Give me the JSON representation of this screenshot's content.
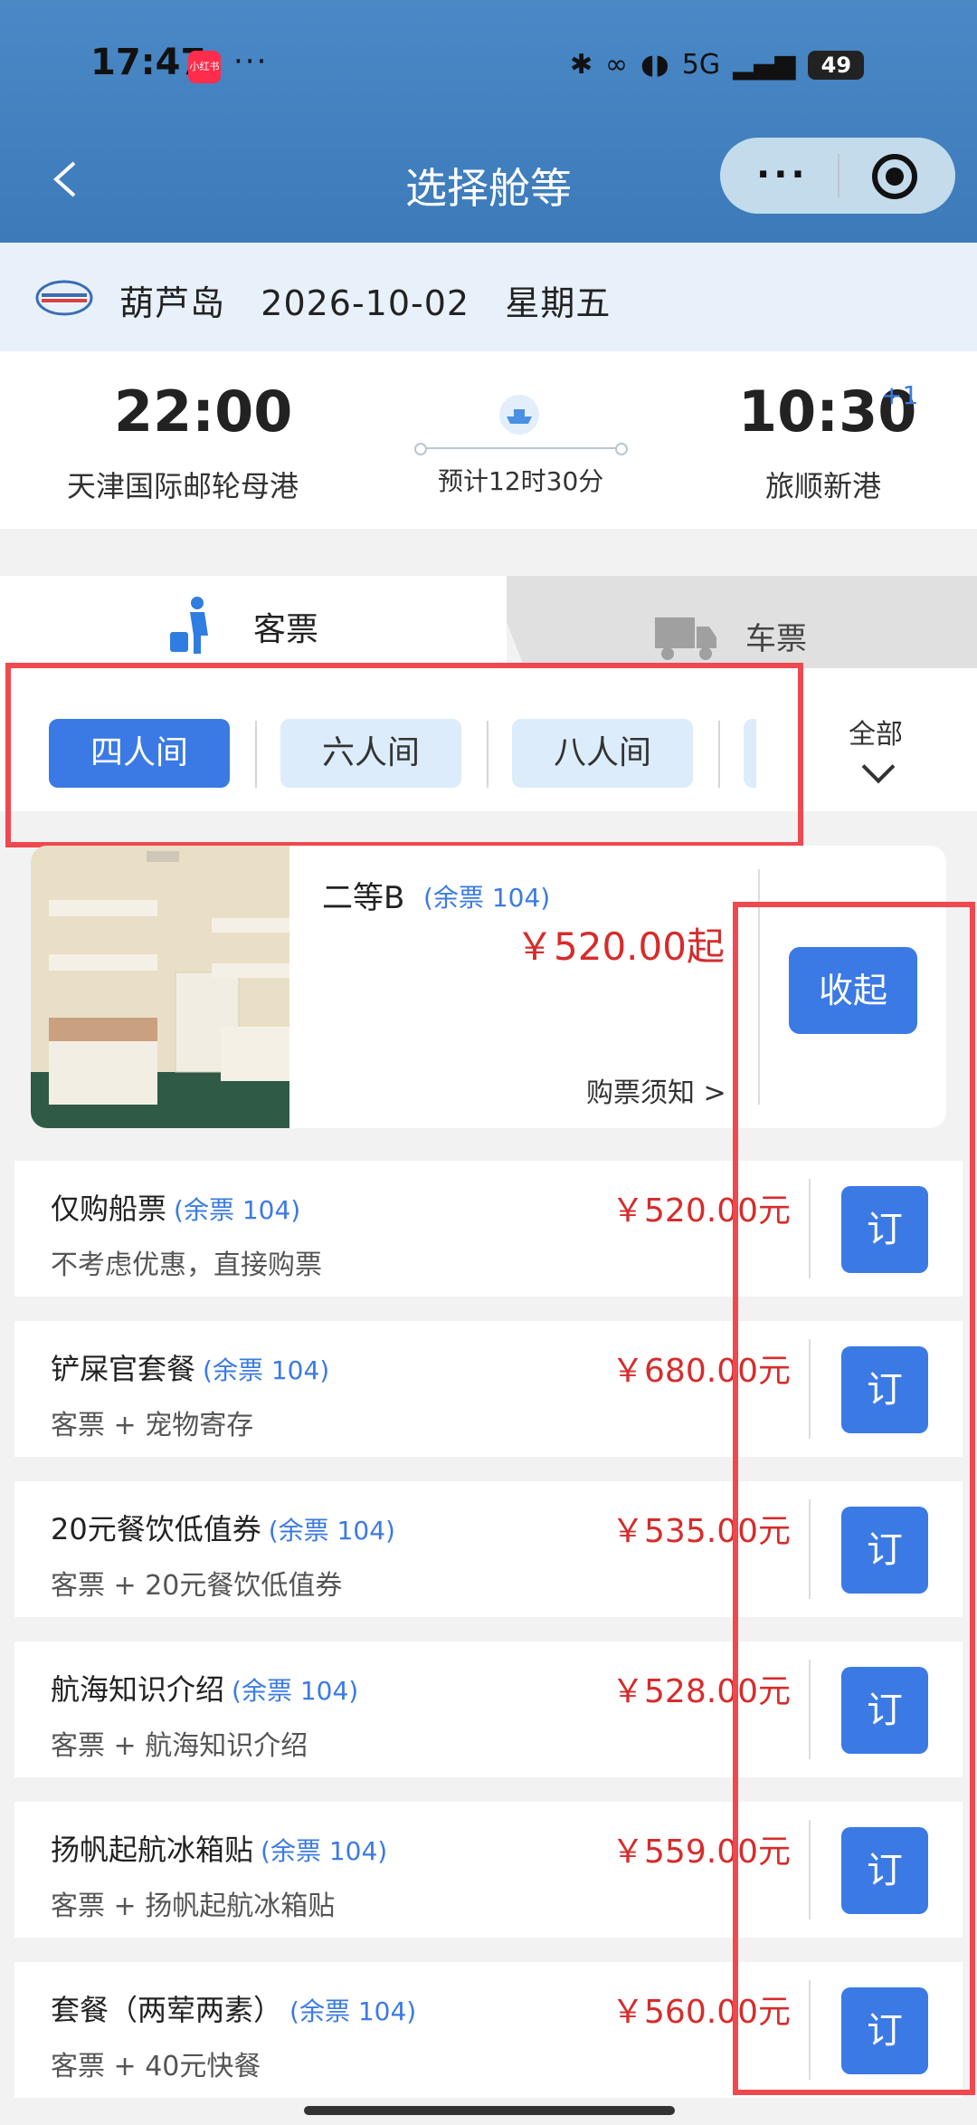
{
  "status": {
    "time": "17:47",
    "app_badge": "小红书",
    "dots": "···",
    "signal": "5G",
    "battery": "49"
  },
  "header": {
    "title": "选择舱等",
    "more": "···"
  },
  "route": {
    "dest": "葫芦岛",
    "date": "2026-10-02",
    "weekday": "星期五"
  },
  "schedule": {
    "dep_time": "22:00",
    "dep_port": "天津国际邮轮母港",
    "duration": "预计12时30分",
    "arr_time": "10:30",
    "arr_plus": "+1",
    "arr_port": "旅顺新港"
  },
  "tabs": {
    "passenger": "客票",
    "vehicle": "车票"
  },
  "cabin_types": {
    "items": [
      "四人间",
      "六人间",
      "八人间"
    ],
    "all": "全部"
  },
  "cabin": {
    "name": "二等B",
    "avail": "(余票 104)",
    "price": "￥520.00起",
    "notice": "购票须知 >",
    "collapse": "收起"
  },
  "packages": [
    {
      "name": "仅购船票",
      "avail": "(余票 104)",
      "desc": "不考虑优惠，直接购票",
      "price": "￥520.00元",
      "book": "订"
    },
    {
      "name": "铲屎官套餐",
      "avail": "(余票 104)",
      "desc": "客票 + 宠物寄存",
      "price": "￥680.00元",
      "book": "订"
    },
    {
      "name": "20元餐饮低值券",
      "avail": "(余票 104)",
      "desc": "客票 + 20元餐饮低值券",
      "price": "￥535.00元",
      "book": "订"
    },
    {
      "name": "航海知识介绍",
      "avail": "(余票 104)",
      "desc": "客票 + 航海知识介绍",
      "price": "￥528.00元",
      "book": "订"
    },
    {
      "name": "扬帆起航冰箱贴",
      "avail": "(余票 104)",
      "desc": "客票 + 扬帆起航冰箱贴",
      "price": "￥559.00元",
      "book": "订"
    },
    {
      "name": "套餐（两荤两素）",
      "avail": "(余票 104)",
      "desc": "客票 + 40元快餐",
      "price": "￥560.00元",
      "book": "订"
    }
  ],
  "colors": {
    "accent": "#3b7ae4",
    "price": "#d62c2c",
    "highlight": "#f0484f",
    "header": "#3c7ab9"
  }
}
